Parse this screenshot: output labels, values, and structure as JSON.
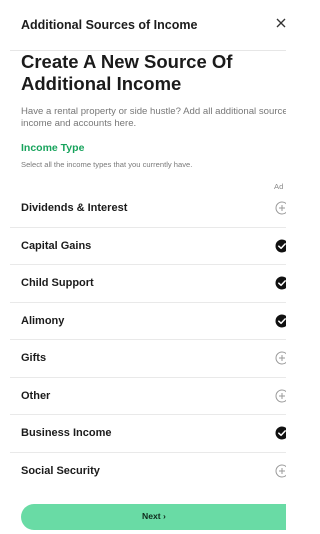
{
  "dialog": {
    "title": "Additional Sources of Income",
    "close_label": "×"
  },
  "heading": "Create A New Source Of Additional Income",
  "subtext": "Have a rental property or side hustle? Add all additional sources of income and accounts here.",
  "income_type": {
    "label": "Income Type",
    "help": "Select all the income types that you currently have.",
    "column_header": "Ad",
    "items": [
      {
        "label": "Dividends & Interest",
        "selected": false,
        "icon": "add-circle-icon"
      },
      {
        "label": "Capital Gains",
        "selected": true,
        "icon": "check-circle-icon"
      },
      {
        "label": "Child Support",
        "selected": true,
        "icon": "check-circle-icon"
      },
      {
        "label": "Alimony",
        "selected": true,
        "icon": "check-circle-icon"
      },
      {
        "label": "Gifts",
        "selected": false,
        "icon": "add-circle-icon"
      },
      {
        "label": "Other",
        "selected": false,
        "icon": "add-circle-icon"
      },
      {
        "label": "Business Income",
        "selected": true,
        "icon": "check-circle-icon"
      },
      {
        "label": "Social Security",
        "selected": false,
        "icon": "add-circle-icon"
      }
    ]
  },
  "footer": {
    "next_label": "Next  ›"
  },
  "colors": {
    "accent_green": "#17a35c",
    "button_green": "#69dba5",
    "selected_icon": "#111111",
    "unselected_icon": "#9a9a9a"
  }
}
